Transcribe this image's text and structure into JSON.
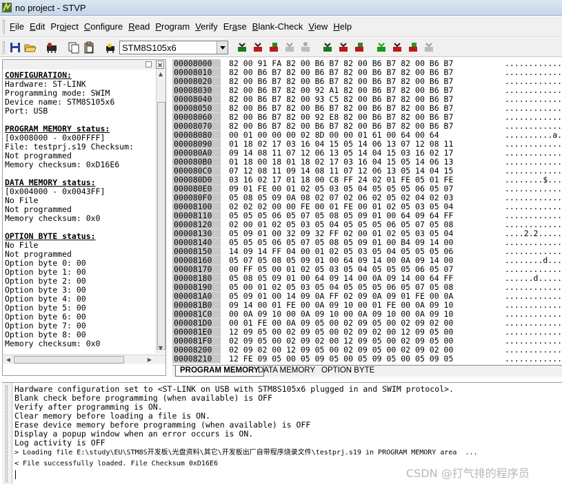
{
  "window": {
    "title": "no project - STVP"
  },
  "menu": [
    {
      "pre": "",
      "key": "F",
      "post": "ile"
    },
    {
      "pre": "",
      "key": "E",
      "post": "dit"
    },
    {
      "pre": "Pr",
      "key": "o",
      "post": "ject"
    },
    {
      "pre": "",
      "key": "C",
      "post": "onfigure"
    },
    {
      "pre": "",
      "key": "R",
      "post": "ead"
    },
    {
      "pre": "",
      "key": "P",
      "post": "rogram"
    },
    {
      "pre": "",
      "key": "V",
      "post": "erify"
    },
    {
      "pre": "Er",
      "key": "a",
      "post": "se"
    },
    {
      "pre": "",
      "key": "B",
      "post": "lank-Check"
    },
    {
      "pre": "",
      "key": "V",
      "post": "iew"
    },
    {
      "pre": "",
      "key": "H",
      "post": "elp"
    }
  ],
  "toolbar": {
    "device": "STM8S105x6"
  },
  "config_panel": {
    "lines": [
      {
        "t": "CONFIGURATION:",
        "h": true
      },
      {
        "t": "Hardware: ST-LINK"
      },
      {
        "t": "Programming mode: SWIM"
      },
      {
        "t": "Device name: STM8S105x6"
      },
      {
        "t": "Port: USB"
      },
      {
        "t": " "
      },
      {
        "t": "PROGRAM MEMORY status:",
        "h": true
      },
      {
        "t": "[0x008000 - 0x00FFFF]"
      },
      {
        "t": "File: testprj.s19 Checksum:"
      },
      {
        "t": "Not programmed"
      },
      {
        "t": "Memory checksum: 0xD16E6"
      },
      {
        "t": " "
      },
      {
        "t": "DATA MEMORY status:",
        "h": true
      },
      {
        "t": "[0x004000 - 0x0043FF]"
      },
      {
        "t": "No File"
      },
      {
        "t": "Not programmed"
      },
      {
        "t": "Memory checksum: 0x0"
      },
      {
        "t": " "
      },
      {
        "t": "OPTION BYTE status:",
        "h": true
      },
      {
        "t": "No File"
      },
      {
        "t": "Not programmed"
      },
      {
        "t": "Option byte 0: 00"
      },
      {
        "t": "Option byte 1: 00"
      },
      {
        "t": "Option byte 2: 00"
      },
      {
        "t": "Option byte 3: 00"
      },
      {
        "t": "Option byte 4: 00"
      },
      {
        "t": "Option byte 5: 00"
      },
      {
        "t": "Option byte 6: 00"
      },
      {
        "t": "Option byte 7: 00"
      },
      {
        "t": "Option byte 8: 00"
      },
      {
        "t": "Memory checksum: 0x0"
      }
    ]
  },
  "memory": {
    "rows": [
      {
        "addr": "00008000",
        "bytes": "82 00 91 FA 82 00 B6 B7 82 00 B6 B7 82 00 B6 B7",
        "ascii": "................"
      },
      {
        "addr": "00008010",
        "bytes": "82 00 B6 B7 82 00 B6 B7 82 00 B6 B7 82 00 B6 B7",
        "ascii": "................"
      },
      {
        "addr": "00008020",
        "bytes": "82 00 B6 B7 82 00 B6 B7 82 00 B6 B7 82 00 B6 B7",
        "ascii": "................"
      },
      {
        "addr": "00008030",
        "bytes": "82 00 B6 B7 82 00 92 A1 82 00 B6 B7 82 00 B6 B7",
        "ascii": "................"
      },
      {
        "addr": "00008040",
        "bytes": "82 00 B6 B7 82 00 93 C5 82 00 B6 B7 82 00 B6 B7",
        "ascii": "................"
      },
      {
        "addr": "00008050",
        "bytes": "82 00 B6 B7 82 00 B6 B7 82 00 B6 B7 82 00 B6 B7",
        "ascii": "................"
      },
      {
        "addr": "00008060",
        "bytes": "82 00 B6 B7 82 00 92 E8 82 00 B6 B7 82 00 B6 B7",
        "ascii": "................"
      },
      {
        "addr": "00008070",
        "bytes": "82 00 B6 B7 82 00 B6 B7 82 00 B6 B7 82 00 B6 B7",
        "ascii": "................"
      },
      {
        "addr": "00008080",
        "bytes": "00 01 00 00 00 02 8D 00 00 01 61 00 64 00 64",
        "ascii": "..........a.d.d"
      },
      {
        "addr": "00008090",
        "bytes": "01 18 02 17 03 16 04 15 05 14 06 13 07 12 08 11",
        "ascii": "................"
      },
      {
        "addr": "000080A0",
        "bytes": "09 14 08 11 07 12 06 13 05 14 04 15 03 16 02 17",
        "ascii": "................"
      },
      {
        "addr": "000080B0",
        "bytes": "01 18 00 18 01 18 02 17 03 16 04 15 05 14 06 13",
        "ascii": "................"
      },
      {
        "addr": "000080C0",
        "bytes": "07 12 08 11 09 14 08 11 07 12 06 13 05 14 04 15",
        "ascii": "................"
      },
      {
        "addr": "000080D0",
        "bytes": "03 16 02 17 01 18 00 C8 FF 24 02 01 FE 05 01 FE",
        "ascii": "........$......."
      },
      {
        "addr": "000080E0",
        "bytes": "09 01 FE 00 01 02 05 03 05 04 05 05 05 06 05 07",
        "ascii": "................"
      },
      {
        "addr": "000080F0",
        "bytes": "05 08 05 09 0A 08 02 07 02 06 02 05 02 04 02 03",
        "ascii": "................"
      },
      {
        "addr": "00008100",
        "bytes": "02 02 02 00 00 FE 00 01 FE 00 01 02 05 03 05 04",
        "ascii": "................"
      },
      {
        "addr": "00008110",
        "bytes": "05 05 05 06 05 07 05 08 05 09 01 00 64 09 64 FF",
        "ascii": "............d.d."
      },
      {
        "addr": "00008120",
        "bytes": "02 00 01 02 05 03 05 04 05 05 05 06 05 07 05 08",
        "ascii": "................"
      },
      {
        "addr": "00008130",
        "bytes": "05 09 01 00 32 09 32 FF 02 00 01 02 05 03 05 04",
        "ascii": "....2.2........."
      },
      {
        "addr": "00008140",
        "bytes": "05 05 05 06 05 07 05 08 05 09 01 00 B4 09 14 00",
        "ascii": "................"
      },
      {
        "addr": "00008150",
        "bytes": "14 09 14 FF 04 00 01 02 05 03 05 04 05 05 05 06",
        "ascii": "................"
      },
      {
        "addr": "00008160",
        "bytes": "05 07 05 08 05 09 01 00 64 09 14 00 0A 09 14 00",
        "ascii": "........d......."
      },
      {
        "addr": "00008170",
        "bytes": "00 FF 05 00 01 02 05 03 05 04 05 05 05 06 05 07",
        "ascii": "................"
      },
      {
        "addr": "00008180",
        "bytes": "05 08 05 09 01 00 64 09 14 00 0A 09 14 00 64 FF",
        "ascii": "......d.......d."
      },
      {
        "addr": "00008190",
        "bytes": "05 00 01 02 05 03 05 04 05 05 05 06 05 07 05 08",
        "ascii": "................"
      },
      {
        "addr": "000081A0",
        "bytes": "05 09 01 00 14 09 0A FF 02 09 0A 09 01 FE 00 0A",
        "ascii": "................"
      },
      {
        "addr": "000081B0",
        "bytes": "09 14 00 01 FE 00 0A 09 10 00 01 FE 00 0A 09 10",
        "ascii": "................"
      },
      {
        "addr": "000081C0",
        "bytes": "00 0A 09 10 00 0A 09 10 00 0A 09 10 00 0A 09 10",
        "ascii": "................"
      },
      {
        "addr": "000081D0",
        "bytes": "00 01 FE 00 0A 09 05 00 02 09 05 00 02 09 02 00",
        "ascii": "................"
      },
      {
        "addr": "000081E0",
        "bytes": "12 09 05 00 02 09 05 00 02 09 02 00 12 09 05 00",
        "ascii": "................"
      },
      {
        "addr": "000081F0",
        "bytes": "02 09 05 00 02 09 02 00 12 09 05 00 02 09 05 00",
        "ascii": "................"
      },
      {
        "addr": "00008200",
        "bytes": "02 09 02 00 12 09 05 00 02 09 05 00 02 09 02 00",
        "ascii": "................"
      },
      {
        "addr": "00008210",
        "bytes": "12 FE 09 05 00 05 09 05 00 05 09 05 00 05 09 05",
        "ascii": "................"
      }
    ],
    "tabs": [
      {
        "label": "PROGRAM MEMORY",
        "active": true
      },
      {
        "label": "DATA MEMORY",
        "active": false
      },
      {
        "label": "OPTION BYTE",
        "active": false
      }
    ]
  },
  "log": {
    "lines": [
      {
        "t": "Hardware configuration set to <ST-LINK on USB with STM8S105x6 plugged in and SWIM protocol>."
      },
      {
        "t": "Blank check before programming (when available) is OFF"
      },
      {
        "t": "Verify after programming is ON."
      },
      {
        "t": "Clear memory before loading a file is ON."
      },
      {
        "t": "Erase device memory before programming (when available) is OFF"
      },
      {
        "t": "Display a popup window when an error occurs is ON."
      },
      {
        "t": "Log activity is OFF"
      },
      {
        "t": "> Loading file E:\\study\\EU\\STM8S开发板\\光盘资料\\其它\\开发板出厂自带程序烧录文件\\testprj.s19 in PROGRAM MEMORY area  ...",
        "small": true
      },
      {
        "t": "< File successfully loaded. File Checksum 0xD16E6",
        "small": true
      }
    ]
  },
  "watermark": "CSDN @打气排的程序员"
}
